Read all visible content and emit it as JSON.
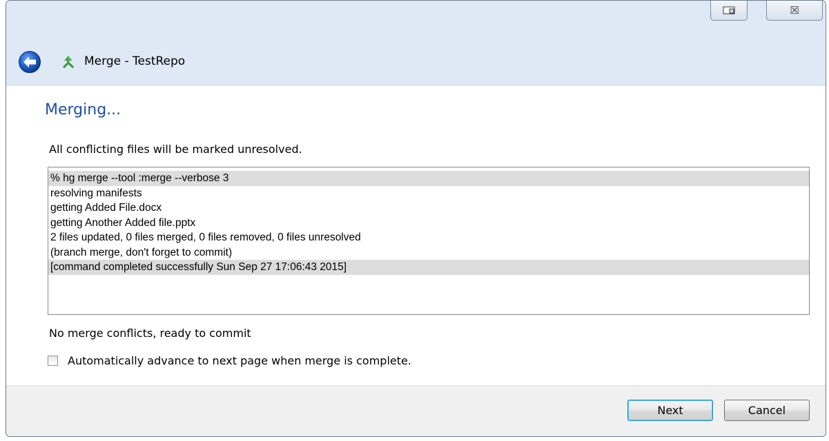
{
  "window": {
    "title": "Merge - TestRepo",
    "icons": {
      "back": "back-arrow-icon",
      "app": "merge-icon",
      "restore": "restore-icon",
      "close": "close-icon"
    },
    "close_glyph": "☒"
  },
  "page": {
    "heading": "Merging...",
    "description": "All conflicting files will be marked unresolved.",
    "log_lines": [
      {
        "text": "% hg merge --tool :merge --verbose 3",
        "highlight": true
      },
      {
        "text": "resolving manifests",
        "highlight": false
      },
      {
        "text": "getting Added File.docx",
        "highlight": false
      },
      {
        "text": "getting Another Added file.pptx",
        "highlight": false
      },
      {
        "text": "2 files updated, 0 files merged, 0 files removed, 0 files unresolved",
        "highlight": false
      },
      {
        "text": "(branch merge, don't forget to commit)",
        "highlight": false
      },
      {
        "text": "[command completed successfully Sun Sep 27 17:06:43 2015]",
        "highlight": true
      }
    ],
    "status": "No merge conflicts, ready to commit",
    "auto_advance": {
      "label": "Automatically advance to next page when merge is complete.",
      "checked": false
    }
  },
  "footer": {
    "next_label": "Next",
    "cancel_label": "Cancel"
  },
  "colors": {
    "heading": "#1e4fa8",
    "frame": "#dfe9f5",
    "log_highlight": "#dcdcdc",
    "footer": "#f0f0f0"
  }
}
